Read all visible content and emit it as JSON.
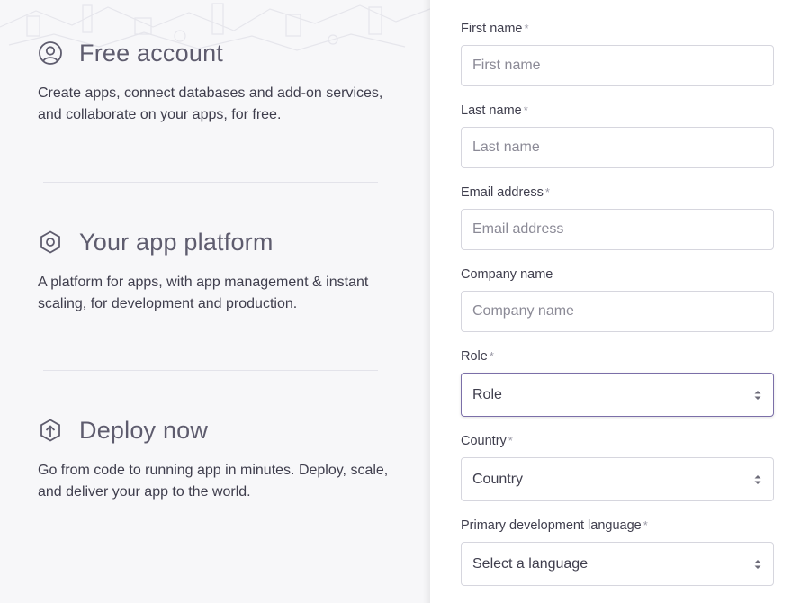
{
  "features": [
    {
      "icon": "user-circle-icon",
      "title": "Free account",
      "description": "Create apps, connect databases and add-on services, and collaborate on your apps, for free."
    },
    {
      "icon": "hexagon-icon",
      "title": "Your app platform",
      "description": "A platform for apps, with app management & instant scaling, for development and production."
    },
    {
      "icon": "upload-arrow-icon",
      "title": "Deploy now",
      "description": "Go from code to running app in minutes. Deploy, scale, and deliver your app to the world."
    }
  ],
  "form": {
    "first_name": {
      "label": "First name",
      "required": "*",
      "placeholder": "First name"
    },
    "last_name": {
      "label": "Last name",
      "required": "*",
      "placeholder": "Last name"
    },
    "email": {
      "label": "Email address",
      "required": "*",
      "placeholder": "Email address"
    },
    "company": {
      "label": "Company name",
      "placeholder": "Company name"
    },
    "role": {
      "label": "Role",
      "required": "*",
      "value": "Role"
    },
    "country": {
      "label": "Country",
      "required": "*",
      "value": "Country"
    },
    "language": {
      "label": "Primary development language",
      "required": "*",
      "value": "Select a language"
    }
  },
  "colors": {
    "accent_border": "#7b6fa8",
    "text": "#3f3e4d",
    "muted": "#8b8a96",
    "panel_bg": "#f7f7f9"
  }
}
